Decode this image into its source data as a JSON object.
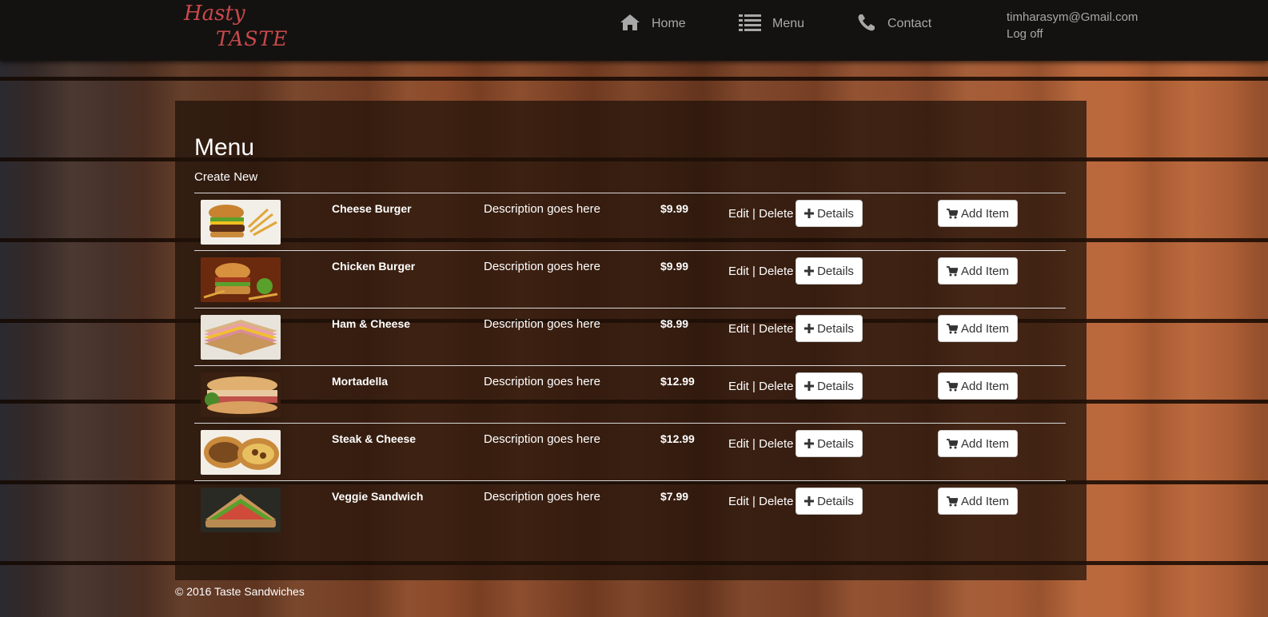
{
  "brand": {
    "line1": "Hasty",
    "line2": "TASTE"
  },
  "nav": {
    "home": {
      "label": "Home",
      "icon": "home-icon"
    },
    "menu": {
      "label": "Menu",
      "icon": "list-icon"
    },
    "contact": {
      "label": "Contact",
      "icon": "phone-icon"
    },
    "user_email": "timharasym@Gmail.com",
    "logoff": "Log off"
  },
  "page": {
    "title": "Menu",
    "create_new": "Create New"
  },
  "items": [
    {
      "name": "Cheese Burger",
      "description": "Description goes here",
      "price": "$9.99",
      "edit": "Edit",
      "sep": "|",
      "delete": "Delete",
      "details": "Details",
      "add": "Add Item"
    },
    {
      "name": "Chicken Burger",
      "description": "Description goes here",
      "price": "$9.99",
      "edit": "Edit",
      "sep": "|",
      "delete": "Delete",
      "details": "Details",
      "add": "Add Item"
    },
    {
      "name": "Ham & Cheese",
      "description": "Description goes here",
      "price": "$8.99",
      "edit": "Edit",
      "sep": "|",
      "delete": "Delete",
      "details": "Details",
      "add": "Add Item"
    },
    {
      "name": "Mortadella",
      "description": "Description goes here",
      "price": "$12.99",
      "edit": "Edit",
      "sep": "|",
      "delete": "Delete",
      "details": "Details",
      "add": "Add Item"
    },
    {
      "name": "Steak & Cheese",
      "description": "Description goes here",
      "price": "$12.99",
      "edit": "Edit",
      "sep": "|",
      "delete": "Delete",
      "details": "Details",
      "add": "Add Item"
    },
    {
      "name": "Veggie Sandwich",
      "description": "Description goes here",
      "price": "$7.99",
      "edit": "Edit",
      "sep": "|",
      "delete": "Delete",
      "details": "Details",
      "add": "Add Item"
    }
  ],
  "footer": {
    "text": "© 2016 Taste Sandwiches"
  }
}
